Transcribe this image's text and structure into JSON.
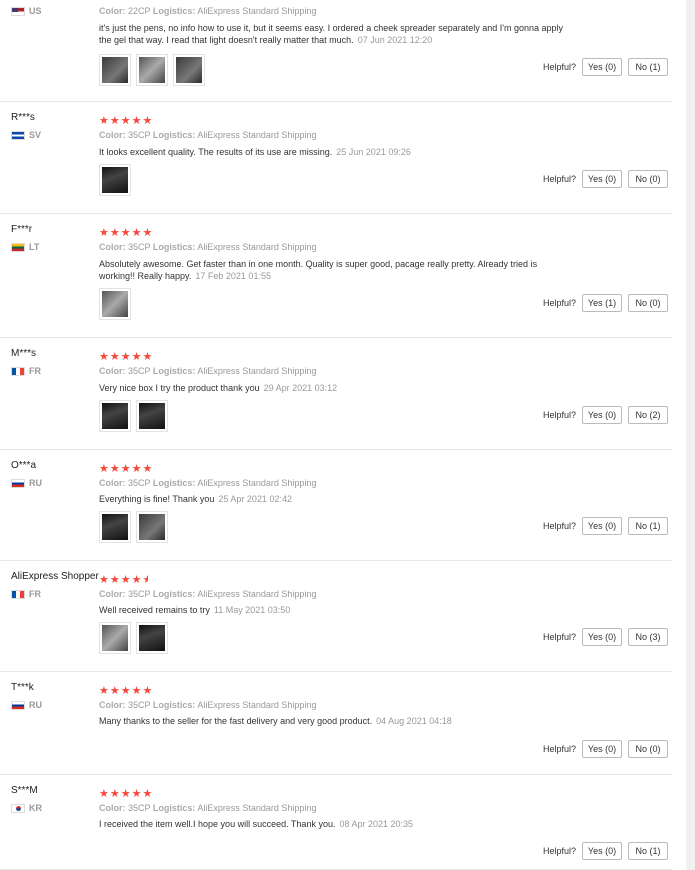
{
  "helpful_label": "Helpful?",
  "reviews": [
    {
      "user": "",
      "country": "US",
      "flag": "us",
      "stars": 0,
      "color_label": "Color:",
      "color": "22CP",
      "logistics_label": "Logistics:",
      "logistics": "AliExpress Standard Shipping",
      "text": "it's just the pens, no info how to use it, but it seems easy. I ordered a cheek spreader separately and I'm gonna apply the gel that way. I read that light doesn't really matter that much.",
      "date": "07 Jun 2021 12:20",
      "yes": "Yes (0)",
      "no": "No (1)",
      "photos": [
        "ph-a",
        "ph-b",
        "ph-a"
      ]
    },
    {
      "user": "R***s",
      "country": "SV",
      "flag": "sv",
      "stars": 5,
      "color_label": "Color:",
      "color": "35CP",
      "logistics_label": "Logistics:",
      "logistics": "AliExpress Standard Shipping",
      "text": "It looks excellent quality. The results of its use are missing.",
      "date": "25 Jun 2021 09:26",
      "yes": "Yes (0)",
      "no": "No (0)",
      "photos": [
        "ph-c"
      ]
    },
    {
      "user": "F***r",
      "country": "LT",
      "flag": "lt",
      "stars": 5,
      "color_label": "Color:",
      "color": "35CP",
      "logistics_label": "Logistics:",
      "logistics": "AliExpress Standard Shipping",
      "text": "Absolutely awesome. Get faster than in one month. Quality is super good, pacage really pretty. Already tried is working!! Really happy.",
      "date": "17 Feb 2021 01:55",
      "yes": "Yes (1)",
      "no": "No (0)",
      "photos": [
        "ph-b"
      ]
    },
    {
      "user": "M***s",
      "country": "FR",
      "flag": "fr",
      "stars": 5,
      "color_label": "Color:",
      "color": "35CP",
      "logistics_label": "Logistics:",
      "logistics": "AliExpress Standard Shipping",
      "text": "Very nice box I try the product thank you",
      "date": "29 Apr 2021 03:12",
      "yes": "Yes (0)",
      "no": "No (2)",
      "photos": [
        "ph-c",
        "ph-c"
      ]
    },
    {
      "user": "O***a",
      "country": "RU",
      "flag": "ru",
      "stars": 5,
      "color_label": "Color:",
      "color": "35CP",
      "logistics_label": "Logistics:",
      "logistics": "AliExpress Standard Shipping",
      "text": "Everything is fine! Thank you",
      "date": "25 Apr 2021 02:42",
      "yes": "Yes (0)",
      "no": "No (1)",
      "photos": [
        "ph-c",
        "ph-a"
      ]
    },
    {
      "user": "AliExpress Shopper",
      "country": "FR",
      "flag": "fr",
      "stars": 4.5,
      "color_label": "Color:",
      "color": "35CP",
      "logistics_label": "Logistics:",
      "logistics": "AliExpress Standard Shipping",
      "text": "Well received remains to try",
      "date": "11 May 2021 03:50",
      "yes": "Yes (0)",
      "no": "No (3)",
      "photos": [
        "ph-b",
        "ph-c"
      ]
    },
    {
      "user": "T***k",
      "country": "RU",
      "flag": "ru",
      "stars": 5,
      "color_label": "Color:",
      "color": "35CP",
      "logistics_label": "Logistics:",
      "logistics": "AliExpress Standard Shipping",
      "text": "Many thanks to the seller for the fast delivery and very good product.",
      "date": "04 Aug 2021 04:18",
      "yes": "Yes (0)",
      "no": "No (0)",
      "photos": []
    },
    {
      "user": "S***M",
      "country": "KR",
      "flag": "kr",
      "stars": 5,
      "color_label": "Color:",
      "color": "35CP",
      "logistics_label": "Logistics:",
      "logistics": "AliExpress Standard Shipping",
      "text": "I received the item well.I hope you will succeed. Thank you.",
      "date": "08 Apr 2021 20:35",
      "yes": "Yes (0)",
      "no": "No (1)",
      "photos": []
    }
  ]
}
